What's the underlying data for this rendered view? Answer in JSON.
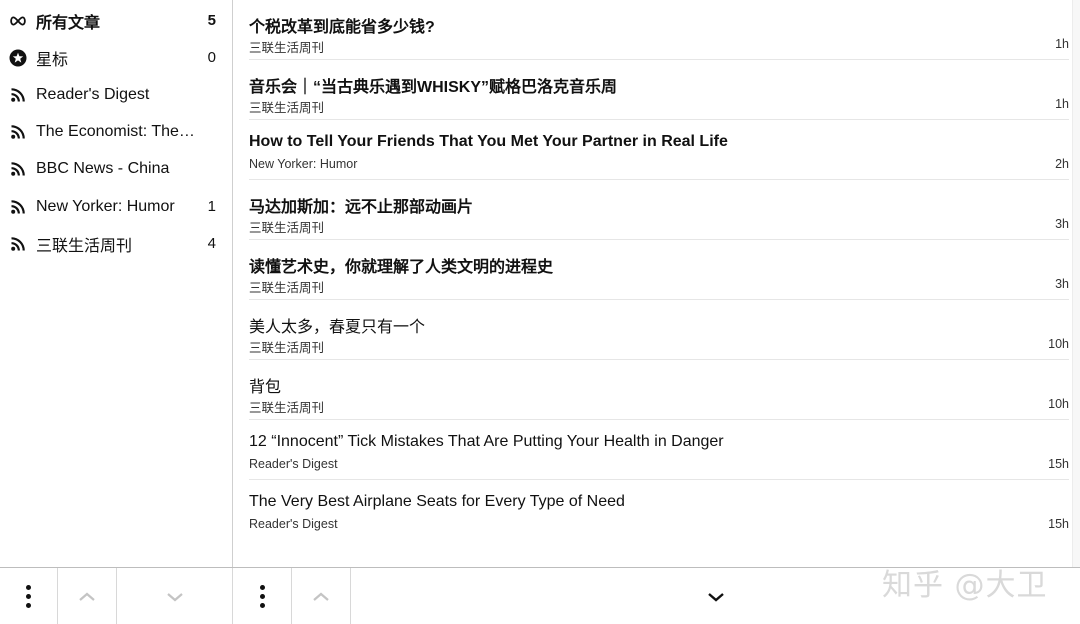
{
  "sidebar": {
    "items": [
      {
        "label": "所有文章",
        "count": "5",
        "icon": "infinity-icon"
      },
      {
        "label": "星标",
        "count": "0",
        "icon": "star-icon"
      },
      {
        "label": "Reader's Digest",
        "count": "",
        "icon": "rss-icon"
      },
      {
        "label": "The Economist: The ...",
        "count": "",
        "icon": "rss-icon"
      },
      {
        "label": "BBC News - China",
        "count": "",
        "icon": "rss-icon"
      },
      {
        "label": "New Yorker: Humor",
        "count": "1",
        "icon": "rss-icon"
      },
      {
        "label": "三联生活周刊",
        "count": "4",
        "icon": "rss-icon"
      }
    ]
  },
  "articles": [
    {
      "title": "个税改革到底能省多少钱?",
      "source": "三联生活周刊",
      "time": "1h",
      "unread": true
    },
    {
      "title": "音乐会｜“当古典乐遇到WHISKY”赋格巴洛克音乐周",
      "source": "三联生活周刊",
      "time": "1h",
      "unread": true
    },
    {
      "title": "How to Tell Your Friends That You Met Your Partner in Real Life",
      "source": "New Yorker: Humor",
      "time": "2h",
      "unread": true
    },
    {
      "title": "马达加斯加：远不止那部动画片",
      "source": "三联生活周刊",
      "time": "3h",
      "unread": true
    },
    {
      "title": "读懂艺术史，你就理解了人类文明的进程史",
      "source": "三联生活周刊",
      "time": "3h",
      "unread": true
    },
    {
      "title": "美人太多，春夏只有一个",
      "source": "三联生活周刊",
      "time": "10h",
      "unread": false
    },
    {
      "title": "背包",
      "source": "三联生活周刊",
      "time": "10h",
      "unread": false
    },
    {
      "title": "12 “Innocent” Tick Mistakes That Are Putting Your Health in Danger",
      "source": "Reader's Digest",
      "time": "15h",
      "unread": false
    },
    {
      "title": "The Very Best Airplane Seats for Every Type of Need",
      "source": "Reader's Digest",
      "time": "15h",
      "unread": false
    }
  ],
  "watermark": "知乎 @大卫",
  "colors": {
    "text": "#111111",
    "divider": "#e6e6e6",
    "watermark": "#d9d9d9"
  }
}
